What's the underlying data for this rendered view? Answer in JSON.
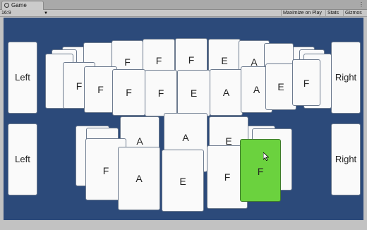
{
  "window": {
    "tab_title": "Game"
  },
  "toolbar": {
    "aspect": "16:9",
    "maximize_on_play": "Maximize on Play",
    "stats": "Stats",
    "gizmos": "Gizmos"
  },
  "side_buttons": {
    "left_top": "Left",
    "left_bottom": "Left",
    "right_top": "Right",
    "right_bottom": "Right"
  },
  "top_hand": {
    "back_letters": [
      "F",
      "F",
      "F",
      "E",
      "A"
    ],
    "front_letters": [
      "F",
      "F",
      "F",
      "F",
      "E",
      "A",
      "A",
      "E",
      "F"
    ]
  },
  "bottom_hand": {
    "back_letters": [
      "A",
      "A",
      "E"
    ],
    "front_letters": [
      "F",
      "A",
      "E",
      "F",
      "F"
    ],
    "selected_index": 4,
    "selected_color": "#6bd23e"
  },
  "colors": {
    "background": "#2c4a7a",
    "card": "#fafafa",
    "selected": "#6bd23e"
  }
}
